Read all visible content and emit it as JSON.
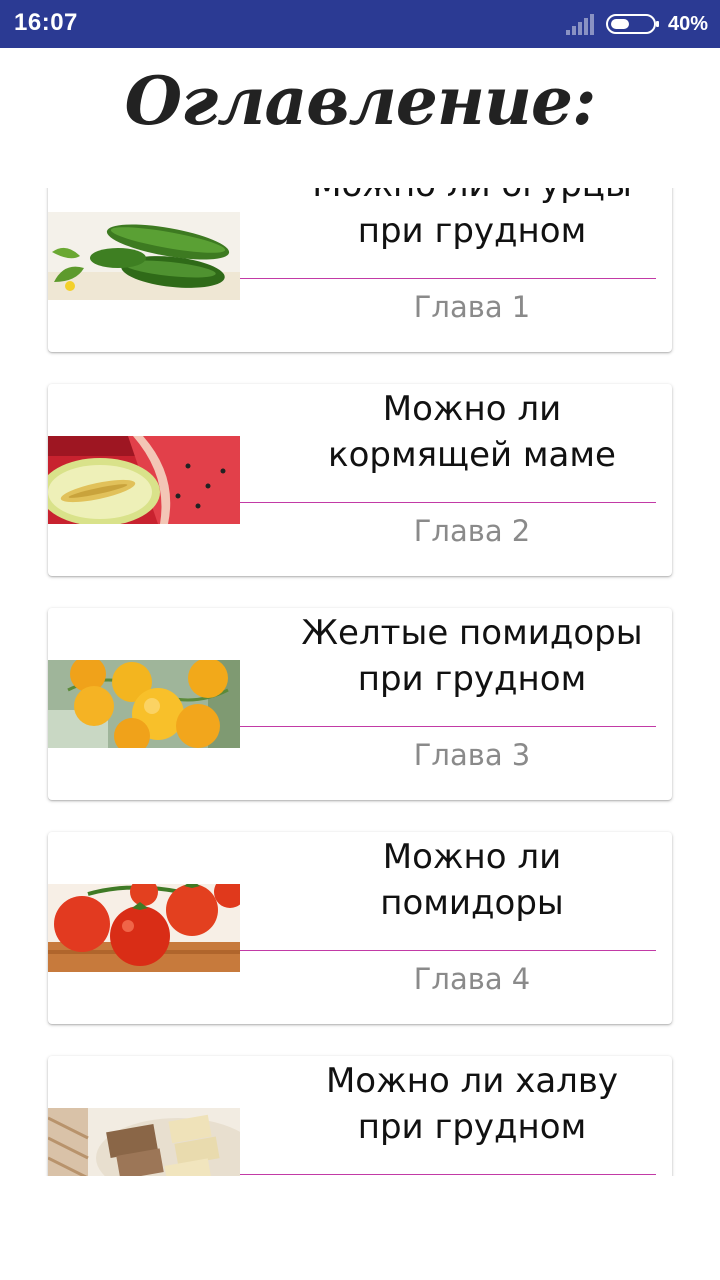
{
  "status_bar": {
    "time": "16:07",
    "battery": "40%",
    "battery_level": 0.4
  },
  "header": {
    "title": "Оглавление:"
  },
  "chapters": [
    {
      "title": "Можно ли огурцы при грудном",
      "chapter": "Глава 1",
      "image": "cucumbers"
    },
    {
      "title": "Можно ли кормящей маме",
      "chapter": "Глава 2",
      "image": "melon-watermelon"
    },
    {
      "title": "Желтые помидоры при грудном",
      "chapter": "Глава 3",
      "image": "yellow-tomatoes"
    },
    {
      "title": "Можно ли помидоры",
      "chapter": "Глава 4",
      "image": "red-tomatoes"
    },
    {
      "title": "Можно ли халву при грудном",
      "chapter": "",
      "image": "halva"
    }
  ],
  "colors": {
    "status_bar": "#2b3a93",
    "divider": "#c23aa6",
    "chapter_text": "#8a8a8a"
  }
}
